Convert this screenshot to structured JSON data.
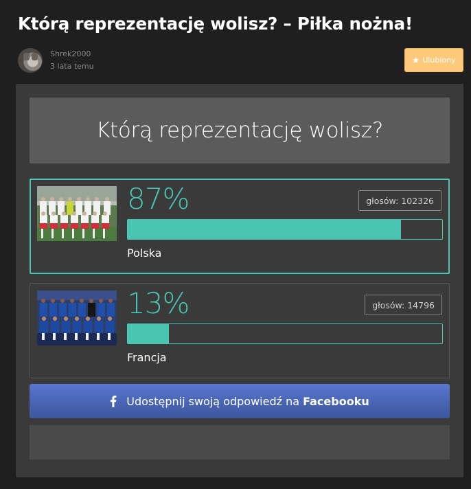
{
  "page": {
    "title": "Którą reprezentację wolisz? – Piłka nożna!"
  },
  "author": {
    "name": "Shrek2000",
    "time": "3 lata temu"
  },
  "favorite": {
    "label": "Ulubiony",
    "icon": "star-icon"
  },
  "quiz": {
    "question": "Którą reprezentację wolisz?",
    "answers": [
      {
        "label": "Polska",
        "percent_text": "87%",
        "percent": 87,
        "votes": "głosów: 102326",
        "selected": true
      },
      {
        "label": "Francja",
        "percent_text": "13%",
        "percent": 13,
        "votes": "głosów: 14796",
        "selected": false
      }
    ],
    "share": {
      "prefix": "Udostępnij swoją odpowiedź na",
      "brand": "Facebooku",
      "icon": "facebook-icon"
    }
  },
  "colors": {
    "accent": "#49c5b1",
    "favorite": "#fec97b",
    "facebook": "#3b579d"
  }
}
